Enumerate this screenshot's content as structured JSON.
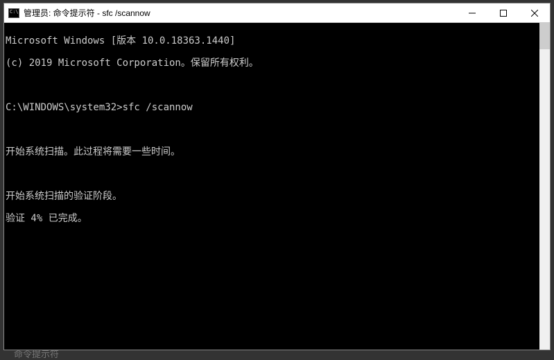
{
  "window": {
    "title": "管理员: 命令提示符 - sfc  /scannow"
  },
  "terminal": {
    "line1": "Microsoft Windows [版本 10.0.18363.1440]",
    "line2": "(c) 2019 Microsoft Corporation。保留所有权利。",
    "blank": "",
    "prompt": "C:\\WINDOWS\\system32>",
    "command": "sfc /scannow",
    "msg1": "开始系统扫描。此过程将需要一些时间。",
    "msg2": "开始系统扫描的验证阶段。",
    "msg3": "验证 4% 已完成。"
  },
  "background": {
    "hint": "命令提示符"
  }
}
